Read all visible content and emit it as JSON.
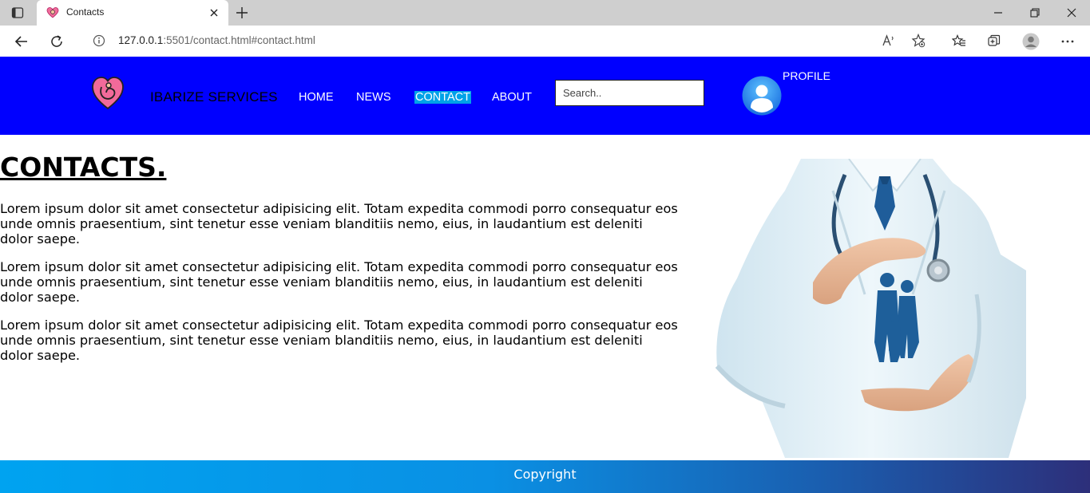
{
  "browser": {
    "tab_title": "Contacts",
    "url_host": "127.0.0.1",
    "url_rest": ":5501/contact.html#contact.html"
  },
  "site": {
    "brand": "IBARIZE SERVICES",
    "nav": [
      {
        "label": "HOME",
        "active": false
      },
      {
        "label": "NEWS",
        "active": false
      },
      {
        "label": "CONTACT",
        "active": true
      },
      {
        "label": "ABOUT",
        "active": false
      }
    ],
    "search_placeholder": "Search..",
    "profile_label": "PROFILE",
    "colors": {
      "header": "#0000ff",
      "active_nav": "#00a2e8"
    }
  },
  "content": {
    "title": "CONTACTS.",
    "paragraphs": [
      "Lorem ipsum dolor sit amet consectetur adipisicing elit. Totam expedita commodi porro consequatur eos unde omnis praesentium, sint tenetur esse veniam blanditiis nemo, eius, in laudantium est deleniti dolor saepe.",
      "Lorem ipsum dolor sit amet consectetur adipisicing elit. Totam expedita commodi porro consequatur eos unde omnis praesentium, sint tenetur esse veniam blanditiis nemo, eius, in laudantium est deleniti dolor saepe.",
      "Lorem ipsum dolor sit amet consectetur adipisicing elit. Totam expedita commodi porro consequatur eos unde omnis praesentium, sint tenetur esse veniam blanditiis nemo, eius, in laudantium est deleniti dolor saepe."
    ]
  },
  "footer": {
    "copyright": "Copyright"
  }
}
